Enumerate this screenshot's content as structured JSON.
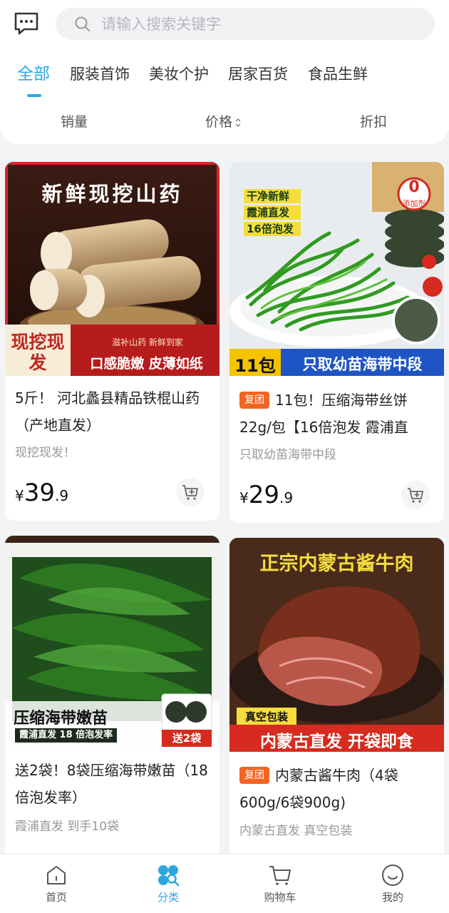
{
  "search": {
    "placeholder": "请输入搜索关键字"
  },
  "tabs": [
    "全部",
    "服装首饰",
    "美妆个护",
    "居家百货",
    "食品生鲜"
  ],
  "sort": {
    "sales": "销量",
    "price": "价格",
    "discount": "折扣"
  },
  "products": [
    {
      "banner": "新鲜现挖山药",
      "badge": "现挖现发",
      "strip_small": "滋补山药 新鲜到家",
      "strip": "口感脆嫩 皮薄如纸",
      "title": "5斤！ 河北蠡县精品铁棍山药（产地直发）",
      "subtitle": "现挖现发！",
      "price_currency": "¥",
      "price_int": "39",
      "price_dec": ".9"
    },
    {
      "label_lines": [
        "干净新鲜",
        "霞浦直发",
        "16倍泡发"
      ],
      "zero_num": "0",
      "zero_text": "添加剂",
      "strip_left": "11包",
      "strip": "只取幼苗海带中段",
      "tag": "复团",
      "title": "11包！压缩海带丝饼22g/包【16倍泡发 霞浦直",
      "subtitle": "只取幼苗海带中段",
      "price_currency": "¥",
      "price_int": "29",
      "price_dec": ".9"
    },
    {
      "banner": "压缩海带嫩苗",
      "banner_sub": "霞浦直发 18 倍泡发率",
      "gift": "送2袋",
      "title": "送2袋！8袋压缩海带嫩苗（18倍泡发率）",
      "subtitle": "霞浦直发 到手10袋"
    },
    {
      "banner": "正宗内蒙古酱牛肉",
      "pack": "真空包装",
      "strip": "内蒙古直发 开袋即食",
      "tag": "复团",
      "title": "内蒙古酱牛肉（4袋600g/6袋900g)",
      "subtitle": "内蒙古直发 真空包装"
    }
  ],
  "bottom_nav": [
    "首页",
    "分类",
    "购物车",
    "我的"
  ],
  "colors": {
    "accent": "#2aa7e2",
    "tag": "#f26522"
  }
}
